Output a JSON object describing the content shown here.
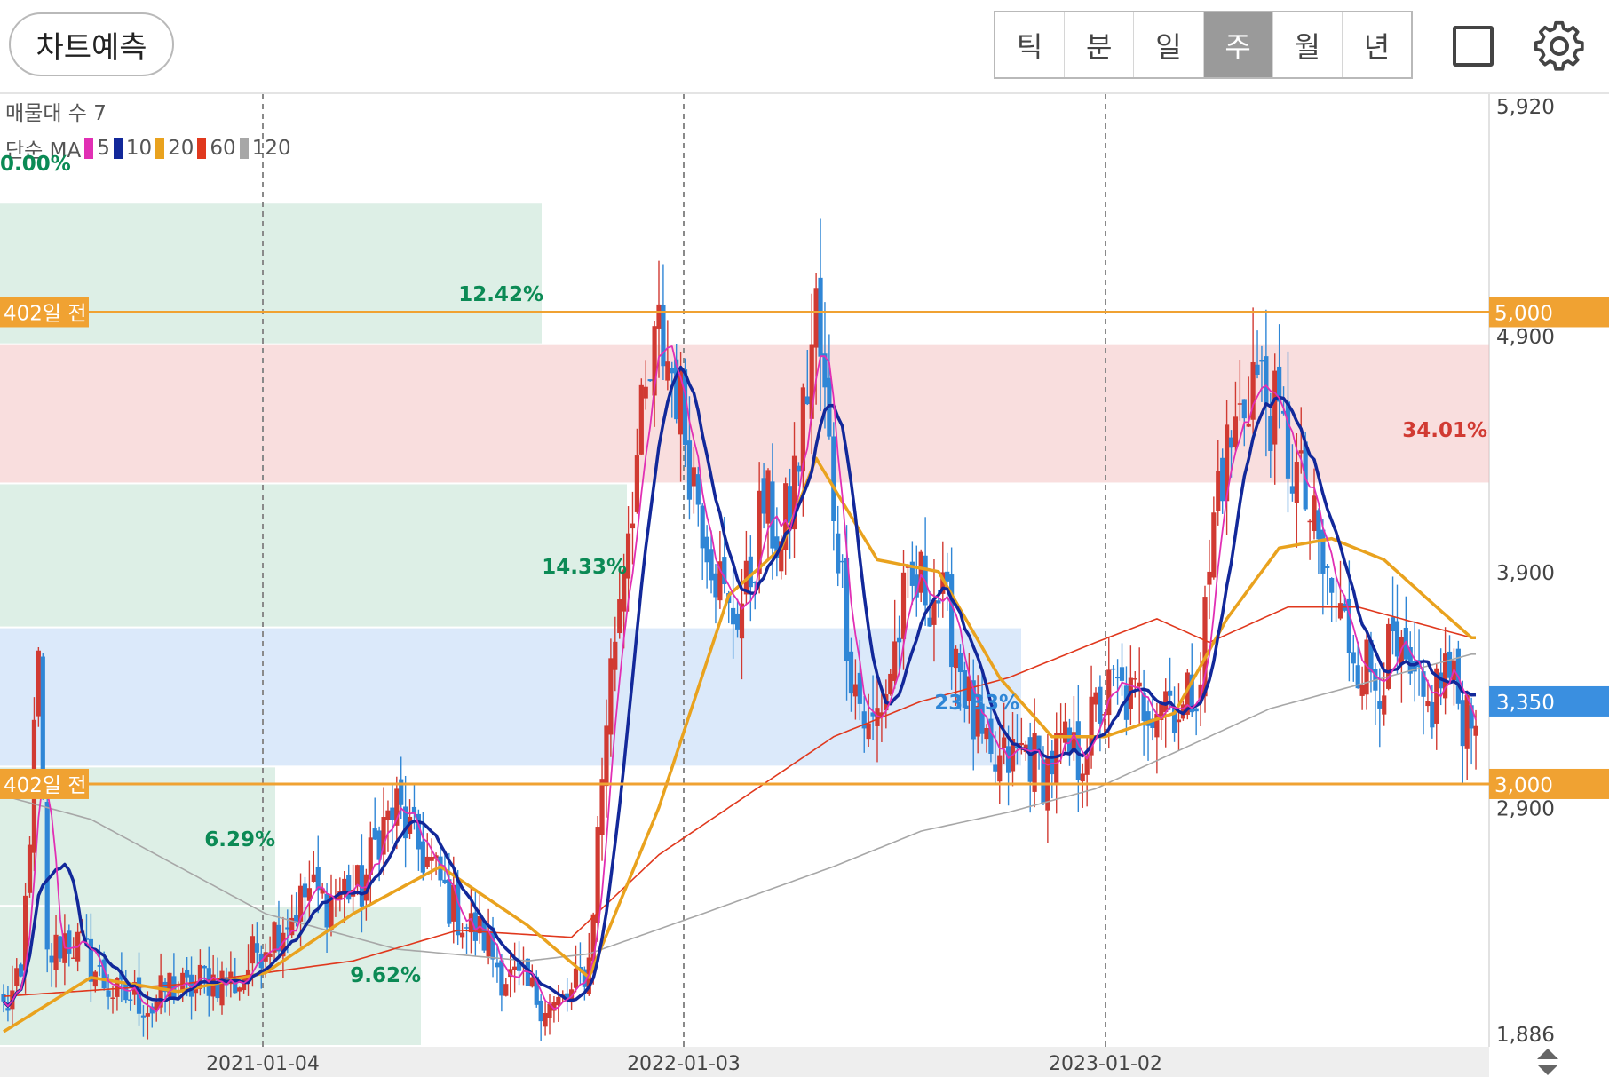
{
  "toolbar": {
    "predict_label": "차트예측",
    "periods": [
      "틱",
      "분",
      "일",
      "주",
      "월",
      "년"
    ],
    "active_period": "주"
  },
  "icons": {
    "layout": "square-icon",
    "settings": "gear-icon",
    "scroll": "up-down-arrows-icon"
  },
  "colors": {
    "up": "#d13a32",
    "down": "#2f86d6",
    "ma5": "#e12fb4",
    "ma10": "#12289a",
    "ma20": "#e9a21e",
    "ma60": "#e0381d",
    "ma120": "#a7a7a7",
    "level": "#f0a232",
    "current": "#3a8fe0"
  },
  "overlay": {
    "volume_profile_label": "매물대 수 7",
    "ma_prefix": "단순 MA",
    "ma_periods": [
      "5",
      "10",
      "20",
      "60",
      "120"
    ],
    "zero_pct": "0.00%"
  },
  "chart_data": {
    "type": "candlestick",
    "y_axis": {
      "range": [
        1886,
        5920
      ],
      "tick_labels": [
        "5,920",
        "4,900",
        "3,900",
        "2,900",
        "1,886"
      ]
    },
    "x_axis": {
      "tick_labels": [
        "2021-01-04",
        "2022-01-03",
        "2023-01-02"
      ]
    },
    "current_price": {
      "label": "3,350",
      "value": 3350
    },
    "levels": [
      {
        "value": 5000,
        "price_label": "5,000",
        "tag": "402일 전"
      },
      {
        "value": 3000,
        "price_label": "3,000",
        "tag": "402일 전"
      }
    ],
    "volume_profile": [
      {
        "low": 4860,
        "high": 5460,
        "pct": "12.42%",
        "color": "green"
      },
      {
        "low": 4270,
        "high": 4860,
        "pct": "34.01%",
        "color": "red"
      },
      {
        "low": 3660,
        "high": 4270,
        "pct": "14.33%",
        "color": "green"
      },
      {
        "low": 3070,
        "high": 3660,
        "pct": "23.33%",
        "color": "blue"
      },
      {
        "low": 2480,
        "high": 3070,
        "pct": "6.29%",
        "color": "green"
      },
      {
        "low": 1886,
        "high": 2480,
        "pct": "9.62%",
        "color": "green"
      }
    ],
    "price_path": [
      {
        "i": 0,
        "c": 2050
      },
      {
        "i": 4,
        "c": 2150
      },
      {
        "i": 8,
        "c": 3500
      },
      {
        "i": 10,
        "c": 2250
      },
      {
        "i": 14,
        "c": 2350
      },
      {
        "i": 18,
        "c": 2300
      },
      {
        "i": 22,
        "c": 2180
      },
      {
        "i": 26,
        "c": 2100
      },
      {
        "i": 30,
        "c": 2100
      },
      {
        "i": 34,
        "c": 2050
      },
      {
        "i": 38,
        "c": 2150
      },
      {
        "i": 42,
        "c": 2120
      },
      {
        "i": 46,
        "c": 2180
      },
      {
        "i": 50,
        "c": 2170
      },
      {
        "i": 54,
        "c": 2160
      },
      {
        "i": 58,
        "c": 2300
      },
      {
        "i": 62,
        "c": 2380
      },
      {
        "i": 66,
        "c": 2450
      },
      {
        "i": 70,
        "c": 2550
      },
      {
        "i": 74,
        "c": 2500
      },
      {
        "i": 78,
        "c": 2560
      },
      {
        "i": 82,
        "c": 2550
      },
      {
        "i": 86,
        "c": 2800
      },
      {
        "i": 90,
        "c": 2900
      },
      {
        "i": 94,
        "c": 2750
      },
      {
        "i": 98,
        "c": 2650
      },
      {
        "i": 102,
        "c": 2500
      },
      {
        "i": 106,
        "c": 2400
      },
      {
        "i": 110,
        "c": 2350
      },
      {
        "i": 114,
        "c": 2200
      },
      {
        "i": 118,
        "c": 2150
      },
      {
        "i": 122,
        "c": 2100
      },
      {
        "i": 126,
        "c": 2050
      },
      {
        "i": 130,
        "c": 2100
      },
      {
        "i": 134,
        "c": 2250
      },
      {
        "i": 138,
        "c": 3300
      },
      {
        "i": 142,
        "c": 4000
      },
      {
        "i": 146,
        "c": 4500
      },
      {
        "i": 150,
        "c": 4900
      },
      {
        "i": 154,
        "c": 4700
      },
      {
        "i": 158,
        "c": 4300
      },
      {
        "i": 162,
        "c": 4000
      },
      {
        "i": 166,
        "c": 3700
      },
      {
        "i": 170,
        "c": 3800
      },
      {
        "i": 174,
        "c": 4200
      },
      {
        "i": 178,
        "c": 4000
      },
      {
        "i": 182,
        "c": 4400
      },
      {
        "i": 186,
        "c": 5000
      },
      {
        "i": 190,
        "c": 4200
      },
      {
        "i": 194,
        "c": 3500
      },
      {
        "i": 198,
        "c": 3200
      },
      {
        "i": 202,
        "c": 3400
      },
      {
        "i": 206,
        "c": 3750
      },
      {
        "i": 210,
        "c": 3850
      },
      {
        "i": 214,
        "c": 3800
      },
      {
        "i": 218,
        "c": 3600
      },
      {
        "i": 222,
        "c": 3250
      },
      {
        "i": 226,
        "c": 3050
      },
      {
        "i": 230,
        "c": 3100
      },
      {
        "i": 234,
        "c": 3150
      },
      {
        "i": 238,
        "c": 3050
      },
      {
        "i": 242,
        "c": 3150
      },
      {
        "i": 246,
        "c": 3100
      },
      {
        "i": 250,
        "c": 3300
      },
      {
        "i": 254,
        "c": 3400
      },
      {
        "i": 258,
        "c": 3350
      },
      {
        "i": 262,
        "c": 3350
      },
      {
        "i": 266,
        "c": 3400
      },
      {
        "i": 270,
        "c": 3300
      },
      {
        "i": 274,
        "c": 3500
      },
      {
        "i": 278,
        "c": 4300
      },
      {
        "i": 282,
        "c": 4500
      },
      {
        "i": 286,
        "c": 4750
      },
      {
        "i": 290,
        "c": 4600
      },
      {
        "i": 294,
        "c": 4400
      },
      {
        "i": 298,
        "c": 4200
      },
      {
        "i": 302,
        "c": 3900
      },
      {
        "i": 306,
        "c": 3700
      },
      {
        "i": 310,
        "c": 3550
      },
      {
        "i": 314,
        "c": 3450
      },
      {
        "i": 318,
        "c": 3550
      },
      {
        "i": 322,
        "c": 3400
      },
      {
        "i": 326,
        "c": 3300
      },
      {
        "i": 330,
        "c": 3500
      },
      {
        "i": 334,
        "c": 3300
      },
      {
        "i": 336,
        "c": 3350
      }
    ],
    "ma_path": {
      "ma20": [
        {
          "i": 0,
          "c": 1950
        },
        {
          "i": 20,
          "c": 2180
        },
        {
          "i": 40,
          "c": 2120
        },
        {
          "i": 60,
          "c": 2200
        },
        {
          "i": 80,
          "c": 2450
        },
        {
          "i": 100,
          "c": 2650
        },
        {
          "i": 120,
          "c": 2400
        },
        {
          "i": 134,
          "c": 2180
        },
        {
          "i": 150,
          "c": 2900
        },
        {
          "i": 166,
          "c": 3800
        },
        {
          "i": 178,
          "c": 4000
        },
        {
          "i": 186,
          "c": 4380
        },
        {
          "i": 200,
          "c": 3950
        },
        {
          "i": 214,
          "c": 3900
        },
        {
          "i": 228,
          "c": 3450
        },
        {
          "i": 240,
          "c": 3200
        },
        {
          "i": 252,
          "c": 3200
        },
        {
          "i": 268,
          "c": 3300
        },
        {
          "i": 280,
          "c": 3700
        },
        {
          "i": 292,
          "c": 4000
        },
        {
          "i": 304,
          "c": 4040
        },
        {
          "i": 316,
          "c": 3950
        },
        {
          "i": 328,
          "c": 3750
        },
        {
          "i": 336,
          "c": 3620
        }
      ],
      "ma60": [
        {
          "i": 0,
          "c": 2100
        },
        {
          "i": 40,
          "c": 2150
        },
        {
          "i": 80,
          "c": 2250
        },
        {
          "i": 104,
          "c": 2380
        },
        {
          "i": 130,
          "c": 2350
        },
        {
          "i": 150,
          "c": 2700
        },
        {
          "i": 170,
          "c": 2950
        },
        {
          "i": 190,
          "c": 3200
        },
        {
          "i": 210,
          "c": 3350
        },
        {
          "i": 230,
          "c": 3450
        },
        {
          "i": 250,
          "c": 3600
        },
        {
          "i": 264,
          "c": 3700
        },
        {
          "i": 276,
          "c": 3600
        },
        {
          "i": 294,
          "c": 3750
        },
        {
          "i": 310,
          "c": 3750
        },
        {
          "i": 336,
          "c": 3620
        }
      ],
      "ma120": [
        {
          "i": 0,
          "c": 2950
        },
        {
          "i": 20,
          "c": 2850
        },
        {
          "i": 40,
          "c": 2650
        },
        {
          "i": 60,
          "c": 2450
        },
        {
          "i": 90,
          "c": 2300
        },
        {
          "i": 120,
          "c": 2250
        },
        {
          "i": 134,
          "c": 2280
        },
        {
          "i": 160,
          "c": 2450
        },
        {
          "i": 190,
          "c": 2650
        },
        {
          "i": 210,
          "c": 2800
        },
        {
          "i": 230,
          "c": 2880
        },
        {
          "i": 250,
          "c": 2980
        },
        {
          "i": 270,
          "c": 3150
        },
        {
          "i": 290,
          "c": 3320
        },
        {
          "i": 310,
          "c": 3420
        },
        {
          "i": 336,
          "c": 3550
        }
      ]
    }
  }
}
